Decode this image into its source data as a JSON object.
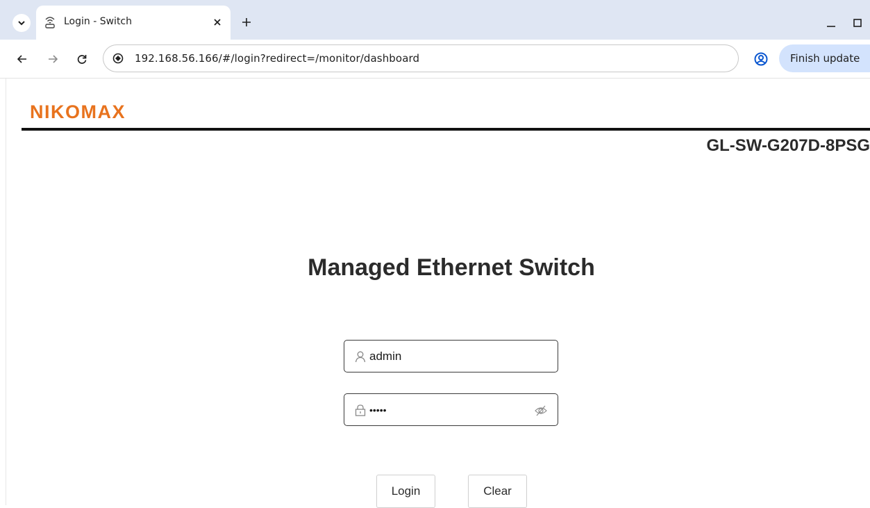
{
  "browser": {
    "tab": {
      "title": "Login - Switch",
      "favicon": "wifi-router-icon",
      "close_icon": "close-icon"
    },
    "new_tab_icon": "plus-icon",
    "tab_menu_icon": "chevron-down-icon",
    "address": "192.168.56.166/#/login?redirect=/monitor/dashboard",
    "update_button": "Finish update",
    "window_controls": [
      "minimize-icon",
      "maximize-icon"
    ]
  },
  "page": {
    "brand": "NIKOMAX",
    "brand_color": "#e8731e",
    "model": "GL-SW-G207D-8PSG",
    "title": "Managed Ethernet Switch",
    "username": {
      "value": "admin",
      "icon": "user-icon"
    },
    "password": {
      "value": "•••••",
      "icon": "lock-icon",
      "toggle_icon": "eye-off-icon"
    },
    "buttons": {
      "login": "Login",
      "clear": "Clear"
    }
  }
}
